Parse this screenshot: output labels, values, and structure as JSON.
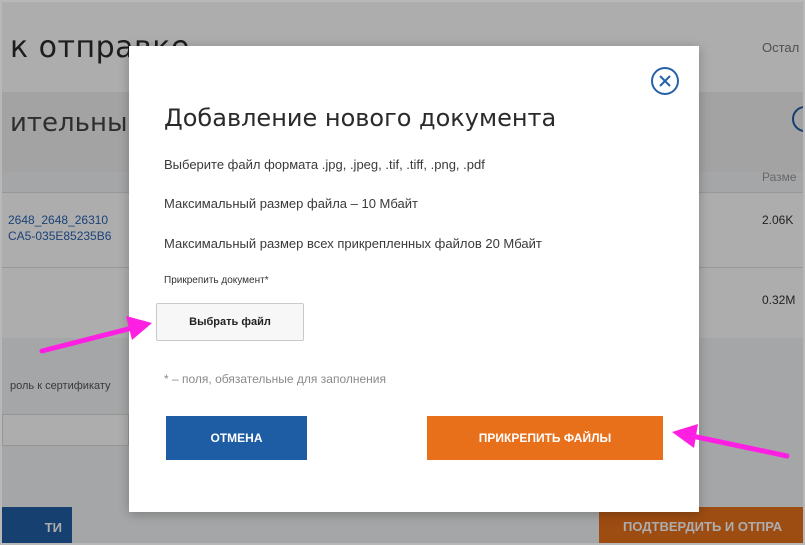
{
  "background": {
    "heading": "к отправке",
    "heading_right": "Остал",
    "section_title": "ительные",
    "col_size_label": "Разме",
    "files": [
      {
        "name_line1": "2648_2648_26310",
        "name_line2": "CA5-035E85235B6",
        "size": "2.06K"
      },
      {
        "name_line1": "",
        "name_line2": "",
        "size": "0.32M"
      }
    ],
    "cert_label": "роль к сертификату",
    "left_button": "ТИ",
    "confirm_button": "ПОДТВЕРДИТЬ И ОТПРА"
  },
  "modal": {
    "title": "Добавление нового документа",
    "formats_text": "Выберите файл формата .jpg, .jpeg, .tif, .tiff, .png, .pdf",
    "max_size_text": "Максимальный размер файла – 10 Мбайт",
    "max_total_text": "Максимальный размер всех прикрепленных файлов 20 Мбайт",
    "attach_label": "Прикрепить документ*",
    "choose_file_button": "Выбрать файл",
    "required_note": "* – поля, обязательные для заполнения",
    "cancel_button": "ОТМЕНА",
    "attach_button": "ПРИКРЕПИТЬ ФАЙЛЫ"
  },
  "icons": {
    "close": "close-icon",
    "arrow": "arrow-icon"
  },
  "colors": {
    "primary_blue": "#1e5ca3",
    "accent_orange": "#e8701b",
    "annotation_arrow": "#ff1fe3"
  }
}
